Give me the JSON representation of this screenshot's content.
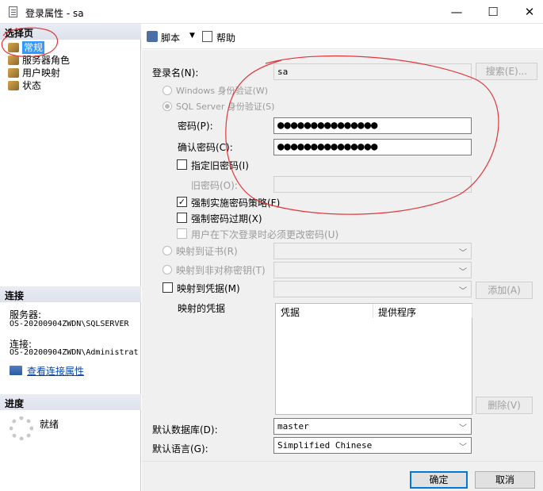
{
  "window": {
    "title": "登录属性 - sa",
    "minimize_glyph": "—",
    "maximize_glyph": "☐",
    "close_glyph": "✕"
  },
  "left": {
    "select_page_header": "选择页",
    "pages": [
      {
        "label": "常规",
        "selected": true
      },
      {
        "label": "服务器角色"
      },
      {
        "label": "用户映射"
      },
      {
        "label": "状态"
      }
    ],
    "connection_header": "连接",
    "server_label": "服务器:",
    "server_value": "OS-20200904ZWDN\\SQLSERVER",
    "connection_label": "连接:",
    "connection_value": "OS-20200904ZWDN\\Administrat",
    "view_connection_props": "查看连接属性",
    "progress_header": "进度",
    "progress_status": "就绪"
  },
  "toolbar": {
    "script_label": "脚本",
    "help_label": "帮助"
  },
  "form": {
    "login_name_label": "登录名(N):",
    "login_name_value": "sa",
    "search_button": "搜索(E)...",
    "windows_auth_label": "Windows 身份验证(W)",
    "sql_auth_label": "SQL Server 身份验证(S)",
    "password_label": "密码(P):",
    "password_value": "●●●●●●●●●●●●●●●",
    "confirm_password_label": "确认密码(C):",
    "confirm_password_value": "●●●●●●●●●●●●●●●",
    "specify_old_password_label": "指定旧密码(I)",
    "old_password_label": "旧密码(O):",
    "enforce_policy_label": "强制实施密码策略(F)",
    "enforce_policy_checked": "✓",
    "enforce_expiration_label": "强制密码过期(X)",
    "must_change_label": "用户在下次登录时必须更改密码(U)",
    "map_cert_label": "映射到证书(R)",
    "map_asym_key_label": "映射到非对称密钥(T)",
    "map_credential_label": "映射到凭据(M)",
    "add_button": "添加(A)",
    "mapped_credentials_label": "映射的凭据",
    "cred_col_credential": "凭据",
    "cred_col_provider": "提供程序",
    "remove_button": "删除(V)",
    "default_db_label": "默认数据库(D):",
    "default_db_value": "master",
    "default_lang_label": "默认语言(G):",
    "default_lang_value": "Simplified Chinese"
  },
  "footer": {
    "ok_button": "确定",
    "cancel_button": "取消"
  },
  "colors": {
    "selection": "#3399ff",
    "annotation": "#e0363a",
    "link": "#0645ad"
  }
}
